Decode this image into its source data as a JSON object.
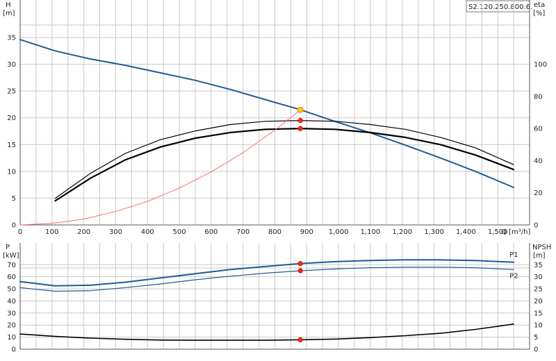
{
  "chart_data": [
    {
      "type": "line",
      "id": "head-efficiency",
      "model_label": "S2.120.250.800.6.",
      "left_axis": {
        "title": "H",
        "unit": "[m]",
        "ylim": [
          0,
          42
        ],
        "ticks": [
          0,
          5,
          10,
          15,
          20,
          25,
          30,
          35
        ]
      },
      "right_axis": {
        "title": "eta",
        "unit": "[%]",
        "ylim": [
          0,
          140
        ],
        "ticks": [
          0,
          20,
          40,
          60,
          80,
          100
        ]
      },
      "x_axis": {
        "title": "Q [m³/h]",
        "xlim": [
          0,
          1600
        ],
        "ticks": [
          0,
          100,
          200,
          300,
          400,
          500,
          600,
          700,
          800,
          900,
          1000,
          1100,
          1200,
          1300,
          1400,
          1500
        ],
        "tick_labels": [
          "0",
          "100",
          "200",
          "300",
          "400",
          "500",
          "600",
          "700",
          "800",
          "900",
          "1,000",
          "1,100",
          "1,200",
          "1,300",
          "1,400",
          "1,500"
        ]
      },
      "grid": true,
      "colors": {
        "head": "#1f5a96",
        "eta": "#000000",
        "system": "#ff6a6a",
        "duty": "#ff2a00",
        "duty_head": "#ffcc00"
      },
      "series": [
        {
          "key": "head",
          "axis": "left",
          "x": [
            0,
            110,
            220,
            330,
            440,
            550,
            660,
            770,
            880,
            990,
            1100,
            1210,
            1320,
            1430,
            1550
          ],
          "y": [
            34.6,
            32.5,
            31.0,
            29.8,
            28.4,
            27.0,
            25.3,
            23.4,
            21.5,
            19.3,
            17.2,
            14.9,
            12.5,
            10.0,
            7.0
          ]
        },
        {
          "key": "eta",
          "axis": "right",
          "width": 2.2,
          "x": [
            110,
            220,
            330,
            440,
            550,
            660,
            770,
            880,
            990,
            1100,
            1210,
            1320,
            1430,
            1550
          ],
          "y": [
            15,
            29,
            40.5,
            48.5,
            54,
            57.5,
            59.5,
            60,
            59.5,
            57.5,
            54.5,
            50,
            43.5,
            34.5
          ]
        },
        {
          "key": "eta",
          "axis": "right",
          "width": 1.2,
          "x": [
            110,
            220,
            330,
            440,
            550,
            660,
            770,
            880,
            990,
            1100,
            1210,
            1320,
            1430,
            1550
          ],
          "y": [
            16.5,
            32,
            44.5,
            53,
            58.5,
            62.5,
            64.5,
            65,
            64.5,
            62.5,
            59.5,
            54.5,
            48,
            37.5
          ]
        },
        {
          "key": "system",
          "axis": "left",
          "width": 1,
          "x": [
            0,
            100,
            200,
            300,
            400,
            500,
            600,
            700,
            800,
            880
          ],
          "y": [
            0,
            0.3,
            1.1,
            2.5,
            4.4,
            6.9,
            9.9,
            13.5,
            17.7,
            21.5
          ]
        }
      ],
      "duty_points": [
        {
          "key": "duty_head",
          "axis": "left",
          "x": 880,
          "y": 21.5
        },
        {
          "key": "duty",
          "axis": "right",
          "x": 880,
          "y": 65
        },
        {
          "key": "duty",
          "axis": "right",
          "x": 880,
          "y": 60
        }
      ]
    },
    {
      "type": "line",
      "id": "power-npsh",
      "left_axis": {
        "title": "P",
        "unit": "[kW]",
        "ylim": [
          0,
          88
        ],
        "ticks": [
          0,
          10,
          20,
          30,
          40,
          50,
          60,
          70
        ]
      },
      "right_axis": {
        "title": "NPSH",
        "unit": "[m]",
        "ylim": [
          0,
          44
        ],
        "ticks": [
          0,
          5,
          10,
          15,
          20,
          25,
          30,
          35
        ]
      },
      "x_axis": {
        "xlim": [
          0,
          1600
        ]
      },
      "grid": true,
      "colors": {
        "power": "#1f5a96",
        "npsh": "#000000",
        "duty": "#ff2a00"
      },
      "series": [
        {
          "key": "power",
          "name": "P1",
          "axis": "left",
          "width": 2,
          "x": [
            0,
            110,
            220,
            330,
            440,
            550,
            660,
            770,
            880,
            990,
            1100,
            1210,
            1320,
            1430,
            1550
          ],
          "y": [
            56,
            52.5,
            53,
            55.5,
            59,
            62.5,
            66,
            68.5,
            71,
            72.5,
            73.5,
            74,
            74,
            73.5,
            72
          ]
        },
        {
          "key": "power",
          "name": "P2",
          "axis": "left",
          "width": 1.2,
          "x": [
            0,
            110,
            220,
            330,
            440,
            550,
            660,
            770,
            880,
            990,
            1100,
            1210,
            1320,
            1430,
            1550
          ],
          "y": [
            51,
            48,
            48.5,
            51,
            54,
            57.5,
            60.5,
            63,
            65,
            66.5,
            67.5,
            68,
            68,
            67.5,
            66
          ]
        },
        {
          "key": "npsh",
          "axis": "right",
          "width": 1.6,
          "x": [
            0,
            110,
            220,
            330,
            440,
            550,
            660,
            770,
            880,
            990,
            1100,
            1210,
            1320,
            1430,
            1550
          ],
          "y": [
            6.3,
            5.3,
            4.6,
            4.1,
            3.8,
            3.7,
            3.7,
            3.7,
            3.9,
            4.2,
            4.8,
            5.6,
            6.6,
            8.2,
            10.4
          ]
        }
      ],
      "duty_points": [
        {
          "key": "duty",
          "axis": "left",
          "x": 880,
          "y": 71
        },
        {
          "key": "duty",
          "axis": "left",
          "x": 880,
          "y": 65
        },
        {
          "key": "duty",
          "axis": "right",
          "x": 880,
          "y": 3.9
        }
      ]
    }
  ]
}
